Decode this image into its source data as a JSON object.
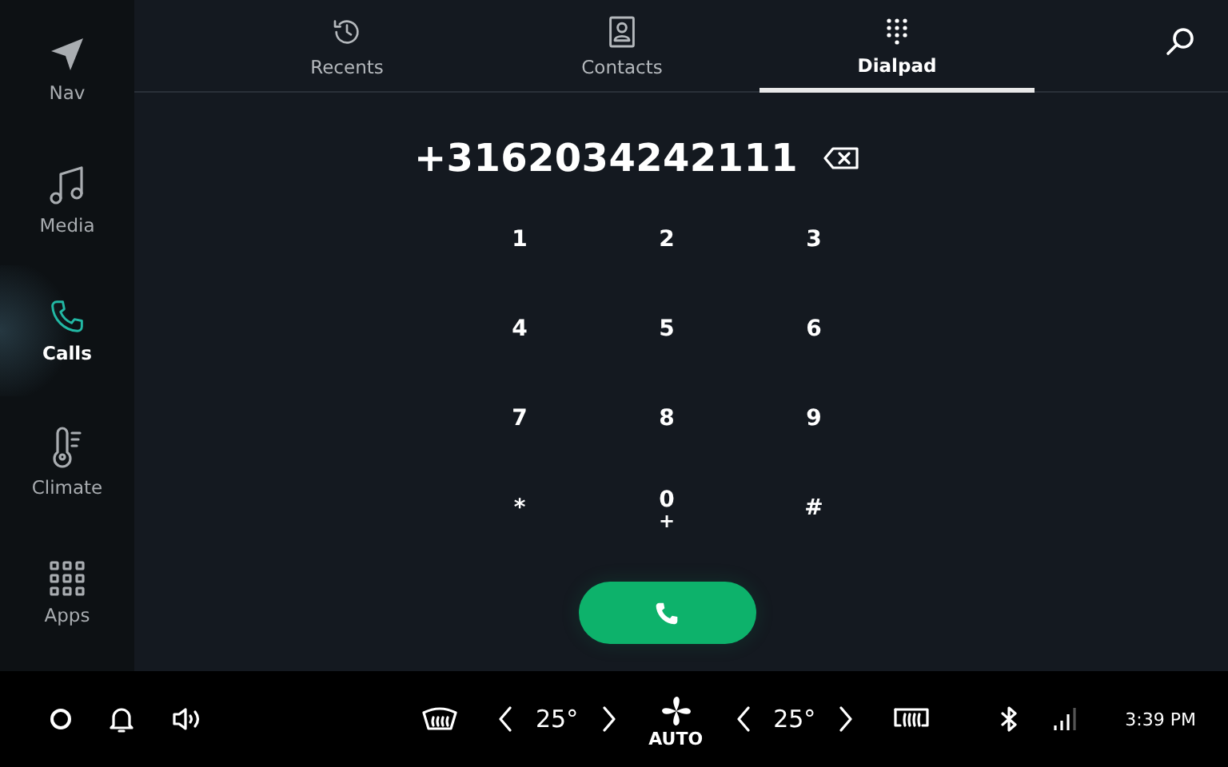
{
  "sidebar": {
    "items": [
      {
        "kind": "nav",
        "label": "Nav",
        "selected": false
      },
      {
        "kind": "media",
        "label": "Media",
        "selected": false
      },
      {
        "kind": "calls",
        "label": "Calls",
        "selected": true
      },
      {
        "kind": "climate",
        "label": "Climate",
        "selected": false
      },
      {
        "kind": "apps",
        "label": "Apps",
        "selected": false
      }
    ]
  },
  "tabs": [
    {
      "kind": "recents",
      "label": "Recents",
      "selected": false
    },
    {
      "kind": "contacts",
      "label": "Contacts",
      "selected": false
    },
    {
      "kind": "dialpad",
      "label": "Dialpad",
      "selected": true
    }
  ],
  "dialer": {
    "number": "+3162034242111"
  },
  "keypad": [
    {
      "digit": "1"
    },
    {
      "digit": "2"
    },
    {
      "digit": "3"
    },
    {
      "digit": "4"
    },
    {
      "digit": "5"
    },
    {
      "digit": "6"
    },
    {
      "digit": "7"
    },
    {
      "digit": "8"
    },
    {
      "digit": "9"
    },
    {
      "digit": "*"
    },
    {
      "digit": "0",
      "sub": "+"
    },
    {
      "digit": "#"
    }
  ],
  "bottom_bar": {
    "left_temp": "25°",
    "fan_mode": "AUTO",
    "right_temp": "25°",
    "time": "3:39 PM"
  }
}
